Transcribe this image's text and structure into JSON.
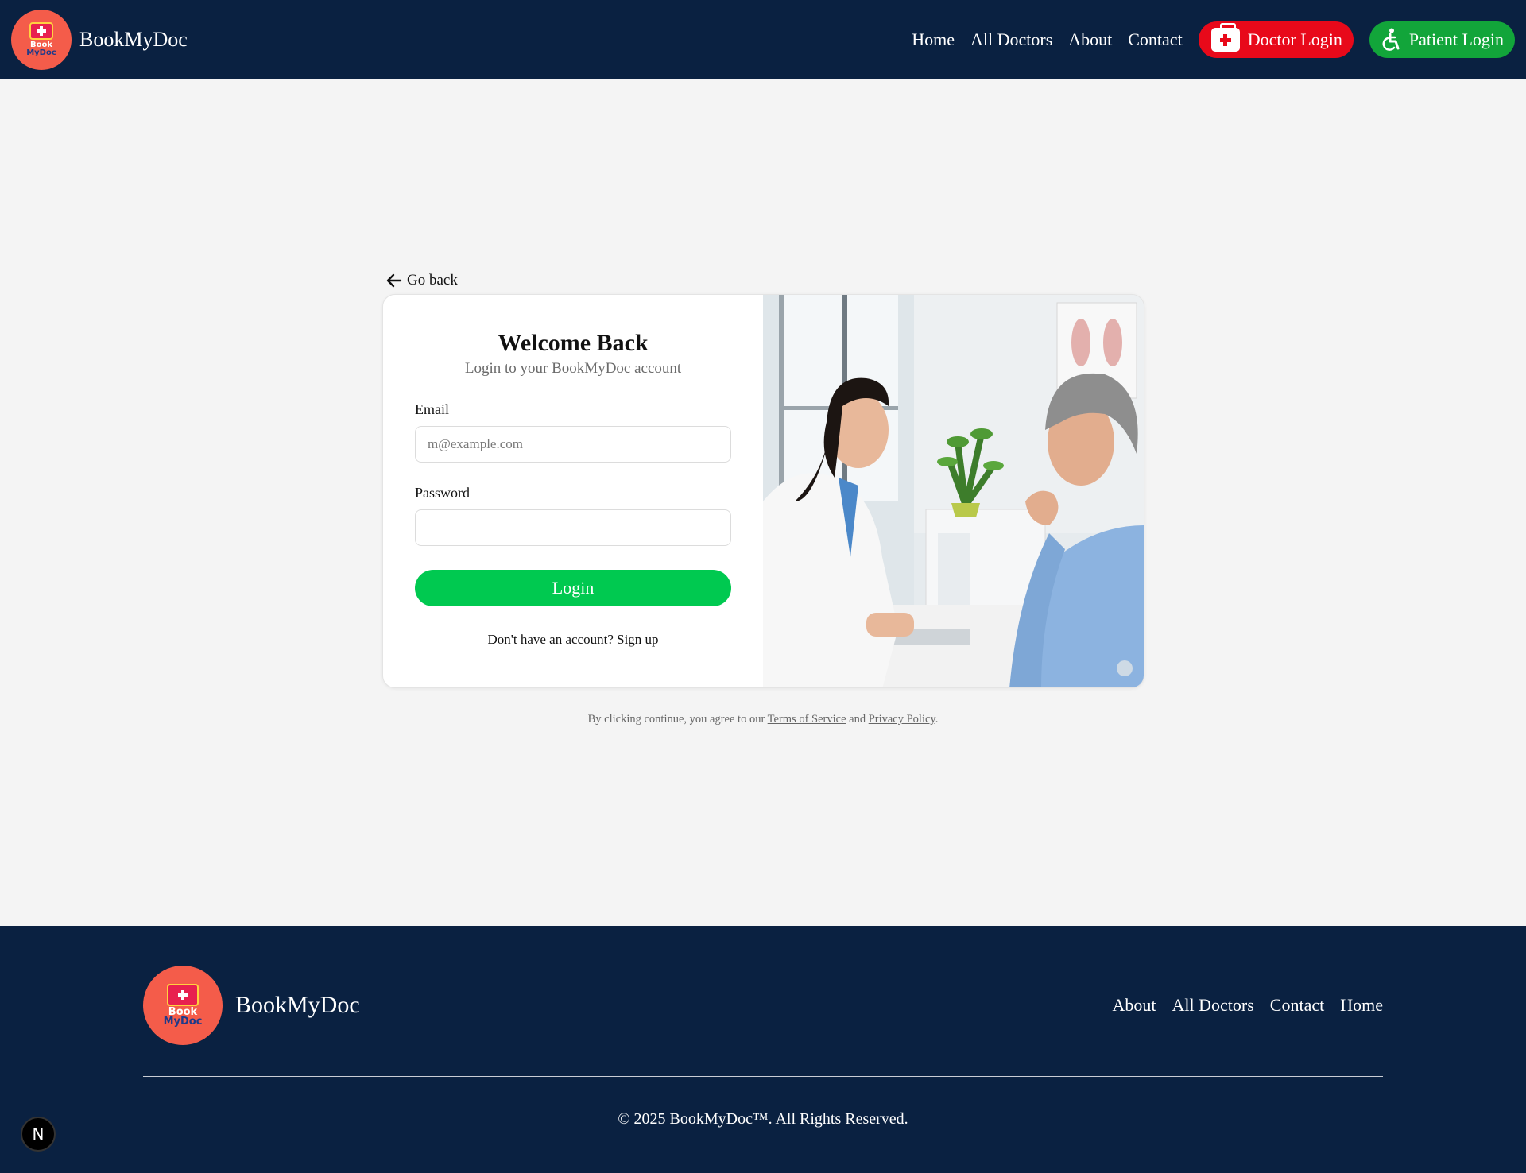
{
  "colors": {
    "navy": "#0a2141",
    "doctor_red": "#e8091a",
    "patient_green": "#12a53a",
    "login_green": "#00c950",
    "logo_coral": "#f45c4a"
  },
  "header": {
    "logo_icon": "bookmydoc-logo",
    "logo_text_1": "Book",
    "logo_text_2": "MyDoc",
    "brand": "BookMyDoc",
    "nav": [
      "Home",
      "All Doctors",
      "About",
      "Contact"
    ],
    "doctor_login": {
      "label": "Doctor Login",
      "icon": "first-aid-kit-icon"
    },
    "patient_login": {
      "label": "Patient Login",
      "icon": "wheelchair-icon"
    }
  },
  "main": {
    "go_back": {
      "label": "Go back",
      "icon": "arrow-left-icon"
    },
    "card": {
      "title": "Welcome Back",
      "subtitle": "Login to your BookMyDoc account",
      "email_label": "Email",
      "email_placeholder": "m@example.com",
      "email_value": "",
      "password_label": "Password",
      "password_value": "",
      "login_button": "Login",
      "signup_prompt": "Don't have an account?",
      "signup_link": "Sign up",
      "image_alt": "Doctor consulting with patient"
    },
    "legal": {
      "prefix": "By clicking continue, you agree to our",
      "terms": "Terms of Service",
      "and": "and",
      "privacy": "Privacy Policy",
      "suffix": "."
    }
  },
  "footer": {
    "logo_text_1": "Book",
    "logo_text_2": "MyDoc",
    "brand": "BookMyDoc",
    "links": [
      "About",
      "All Doctors",
      "Contact",
      "Home"
    ],
    "copyright": "© 2025 BookMyDoc™. All Rights Reserved."
  },
  "dev_badge": {
    "label": "N",
    "icon": "nextjs-icon"
  }
}
